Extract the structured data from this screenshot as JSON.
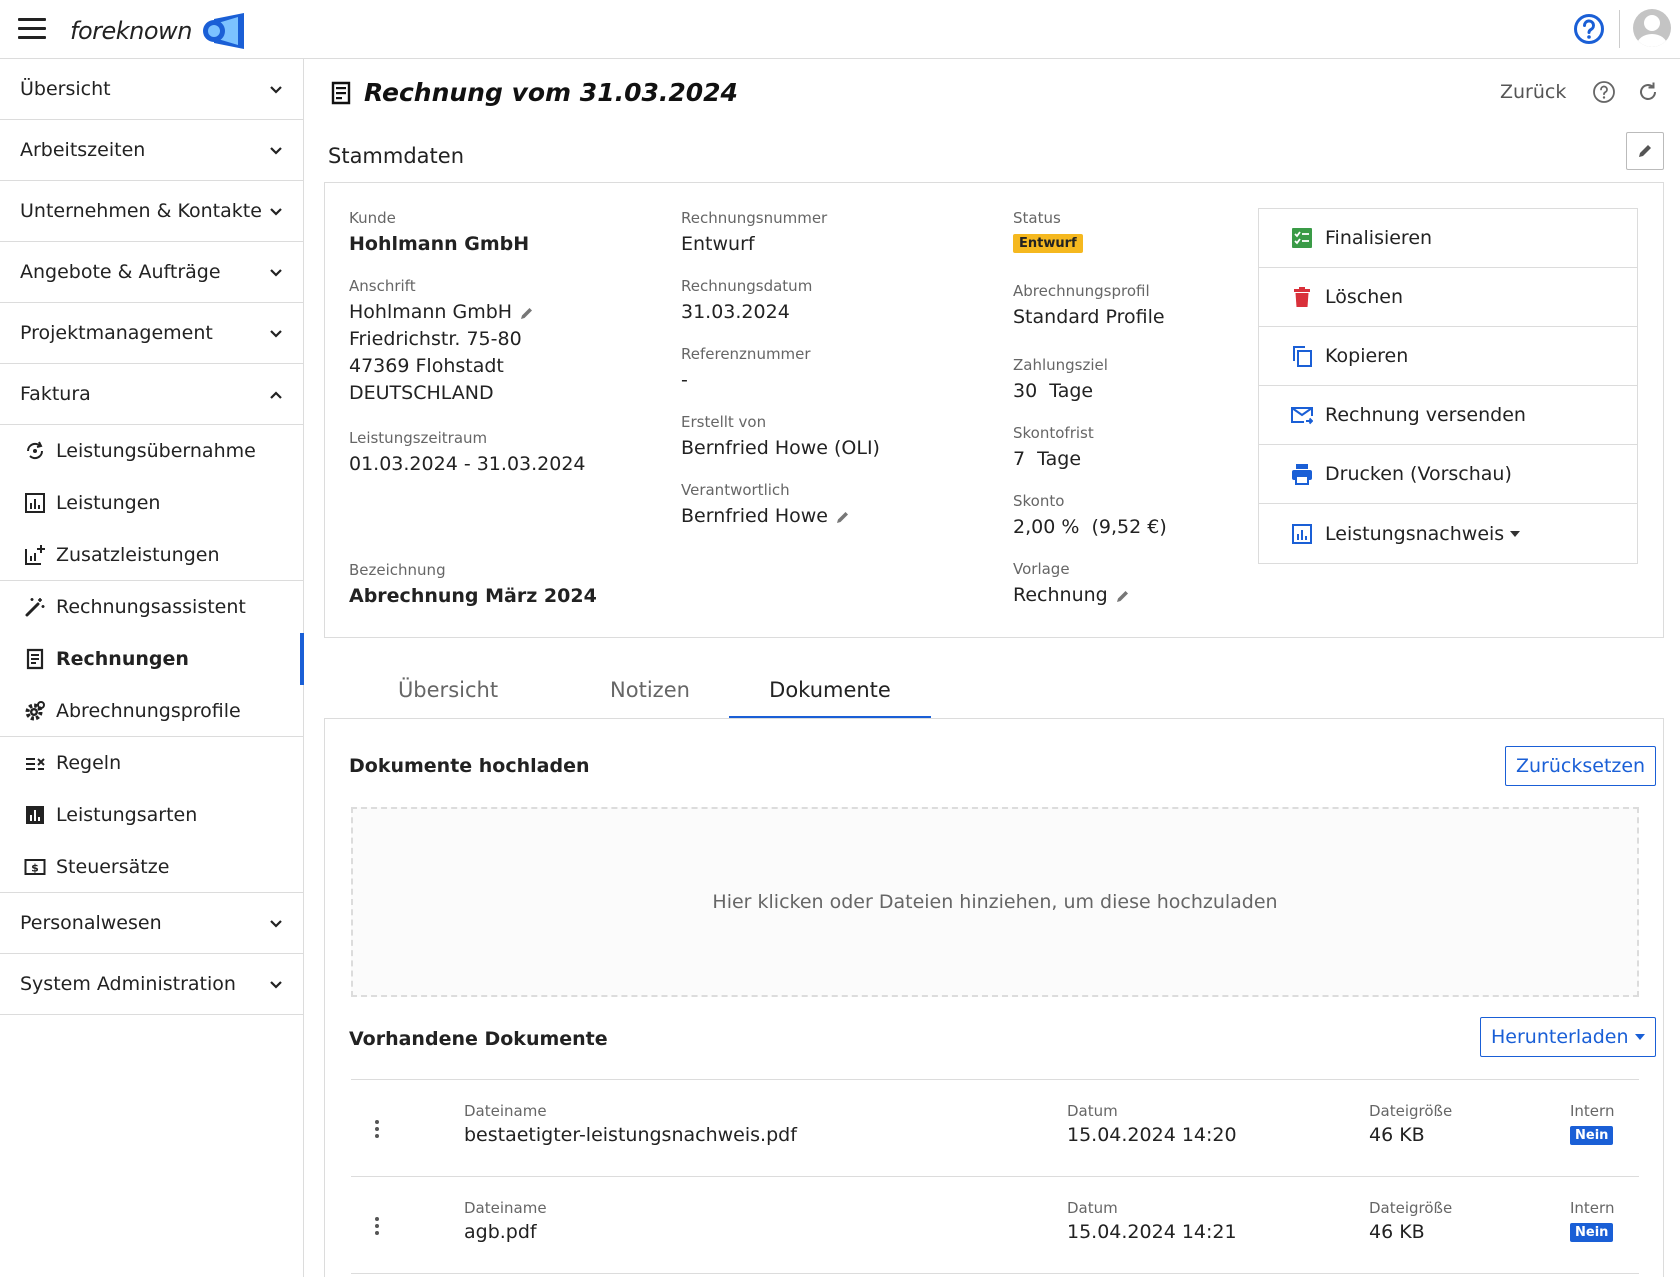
{
  "header": {
    "logo_text": "foreknown"
  },
  "sidebar": {
    "sections_top": [
      {
        "label": "Übersicht"
      },
      {
        "label": "Arbeitszeiten"
      },
      {
        "label": "Unternehmen & Kontakte"
      },
      {
        "label": "Angebote & Aufträge"
      },
      {
        "label": "Projektmanagement"
      }
    ],
    "faktura": {
      "label": "Faktura",
      "items": [
        {
          "label": "Leistungsübernahme",
          "icon": "transfer-icon"
        },
        {
          "label": "Leistungen",
          "icon": "chart-icon"
        },
        {
          "label": "Zusatzleistungen",
          "icon": "chart-plus-icon"
        },
        {
          "label": "Rechnungsassistent",
          "icon": "magic-wand-icon"
        },
        {
          "label": "Rechnungen",
          "icon": "receipt-icon"
        },
        {
          "label": "Abrechnungsprofile",
          "icon": "gear-icon"
        },
        {
          "label": "Regeln",
          "icon": "rules-icon"
        },
        {
          "label": "Leistungsarten",
          "icon": "bar-chart-icon"
        },
        {
          "label": "Steuersätze",
          "icon": "money-icon"
        }
      ]
    },
    "sections_bottom": [
      {
        "label": "Personalwesen"
      },
      {
        "label": "System Administration"
      }
    ]
  },
  "main": {
    "title": "Rechnung vom 31.03.2024",
    "back_label": "Zurück",
    "stammdaten_title": "Stammdaten",
    "fields": {
      "kunde_label": "Kunde",
      "kunde_value": "Hohlmann GmbH",
      "anschrift_label": "Anschrift",
      "anschrift_line1": "Hohlmann GmbH",
      "anschrift_line2": "Friedrichstr. 75-80",
      "anschrift_line3": "47369 Flohstadt",
      "anschrift_line4": "DEUTSCHLAND",
      "zeitraum_label": "Leistungszeitraum",
      "zeitraum_value": "01.03.2024 - 31.03.2024",
      "bezeichnung_label": "Bezeichnung",
      "bezeichnung_value": "Abrechnung März 2024",
      "nummer_label": "Rechnungsnummer",
      "nummer_value": "Entwurf",
      "datum_label": "Rechnungsdatum",
      "datum_value": "31.03.2024",
      "referenz_label": "Referenznummer",
      "referenz_value": "-",
      "erstellt_label": "Erstellt von",
      "erstellt_value": "Bernfried Howe (OLI)",
      "verantwortlich_label": "Verantwortlich",
      "verantwortlich_value": "Bernfried Howe",
      "status_label": "Status",
      "status_value": "Entwurf",
      "profil_label": "Abrechnungsprofil",
      "profil_value": "Standard Profile",
      "zahlungsziel_label": "Zahlungsziel",
      "zahlungsziel_value": "30  Tage",
      "skontofrist_label": "Skontofrist",
      "skontofrist_value": "7  Tage",
      "skonto_label": "Skonto",
      "skonto_value": "2,00 %  (9,52 €)",
      "vorlage_label": "Vorlage",
      "vorlage_value": "Rechnung"
    },
    "actions": [
      {
        "label": "Finalisieren",
        "icon": "checklist-icon"
      },
      {
        "label": "Löschen",
        "icon": "trash-icon"
      },
      {
        "label": "Kopieren",
        "icon": "copy-icon"
      },
      {
        "label": "Rechnung versenden",
        "icon": "mail-send-icon"
      },
      {
        "label": "Drucken (Vorschau)",
        "icon": "printer-icon"
      },
      {
        "label": "Leistungsnachweis",
        "icon": "chart-icon"
      }
    ],
    "tabs": [
      {
        "label": "Übersicht"
      },
      {
        "label": "Notizen"
      },
      {
        "label": "Dokumente"
      }
    ],
    "docs": {
      "upload_title": "Dokumente hochladen",
      "reset_label": "Zurücksetzen",
      "dropzone_text": "Hier klicken oder Dateien hinziehen, um diese hochzuladen",
      "existing_title": "Vorhandene Dokumente",
      "download_label": "Herunterladen",
      "col_name": "Dateiname",
      "col_date": "Datum",
      "col_size": "Dateigröße",
      "col_intern": "Intern",
      "rows": [
        {
          "name": "bestaetigter-leistungsnachweis.pdf",
          "date": "15.04.2024 14:20",
          "size": "46 KB",
          "intern": "Nein"
        },
        {
          "name": "agb.pdf",
          "date": "15.04.2024 14:21",
          "size": "46 KB",
          "intern": "Nein"
        }
      ]
    }
  },
  "colors": {
    "accent": "#1a5fd6",
    "draft_badge": "#f5b81f",
    "finalize_green": "#3a9b47",
    "delete_red": "#d9303a"
  }
}
